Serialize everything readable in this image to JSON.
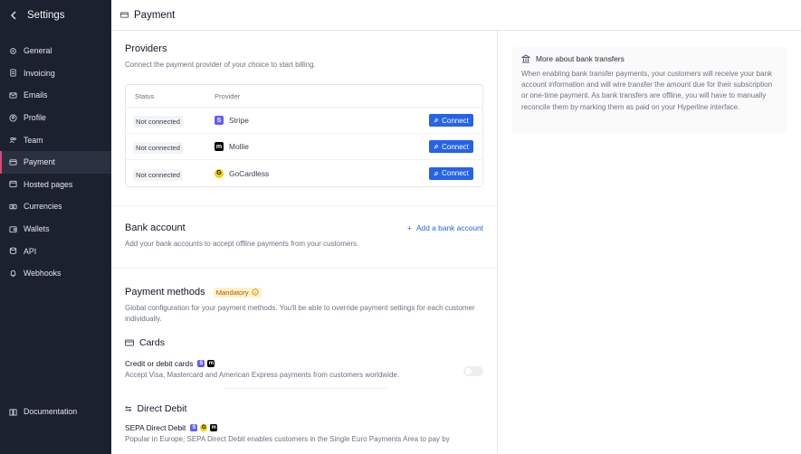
{
  "sidebar": {
    "title": "Settings",
    "items": [
      {
        "label": "General",
        "icon": "settings-icon"
      },
      {
        "label": "Invoicing",
        "icon": "document-icon"
      },
      {
        "label": "Emails",
        "icon": "mail-icon"
      },
      {
        "label": "Profile",
        "icon": "profile-icon"
      },
      {
        "label": "Team",
        "icon": "team-icon"
      },
      {
        "label": "Payment",
        "icon": "card-icon",
        "active": true
      },
      {
        "label": "Hosted pages",
        "icon": "hosted-pages-icon"
      },
      {
        "label": "Currencies",
        "icon": "currency-icon"
      },
      {
        "label": "Wallets",
        "icon": "wallet-icon"
      },
      {
        "label": "API",
        "icon": "database-icon"
      },
      {
        "label": "Webhooks",
        "icon": "bell-icon"
      }
    ],
    "documentation": "Documentation"
  },
  "header": {
    "title": "Payment"
  },
  "providers": {
    "title": "Providers",
    "subtitle": "Connect the payment provider of your choice to start billing.",
    "col_status": "Status",
    "col_provider": "Provider",
    "rows": [
      {
        "status": "Not connected",
        "name": "Stripe",
        "button": "Connect",
        "logo_text": "S",
        "logo_color": "#635bff"
      },
      {
        "status": "Not connected",
        "name": "Mollie",
        "button": "Connect",
        "logo_text": "m",
        "logo_color": "#000000"
      },
      {
        "status": "Not connected",
        "name": "GoCardless",
        "button": "Connect",
        "logo_text": "G",
        "logo_color": "#f2d100"
      }
    ]
  },
  "bank_account": {
    "title": "Bank account",
    "add_label": "Add a bank account",
    "subtitle": "Add your bank accounts to accept offline payments from your customers."
  },
  "payment_methods": {
    "title": "Payment methods",
    "badge": "Mandatory",
    "subtitle": "Global configuration for your payment methods. You'll be able to override payment settings for each customer individually.",
    "cards_title": "Cards",
    "card_label": "Credit or debit cards",
    "card_desc": "Accept Visa, Mastercard and American Express payments from customers worldwide.",
    "direct_debit_title": "Direct Debit",
    "sepa_label": "SEPA Direct Debit",
    "sepa_desc": "Popular in Europe, SEPA Direct Debit enables customers in the Single Euro Payments Area to pay by"
  },
  "info": {
    "title": "More about bank transfers",
    "body": "When enabling bank transfer payments, your customers will receive your bank account information and will wire transfer the amount due for their subscription or one-time payment. As bank transfers are offline, you will have to manually reconcile them by marking them as paid on your Hyperline interface."
  },
  "colors": {
    "sidebar_bg": "#1c2130",
    "active_indicator": "#e0447a",
    "primary": "#2563eb",
    "badge_bg": "#fef3c7",
    "badge_text": "#b45309"
  }
}
